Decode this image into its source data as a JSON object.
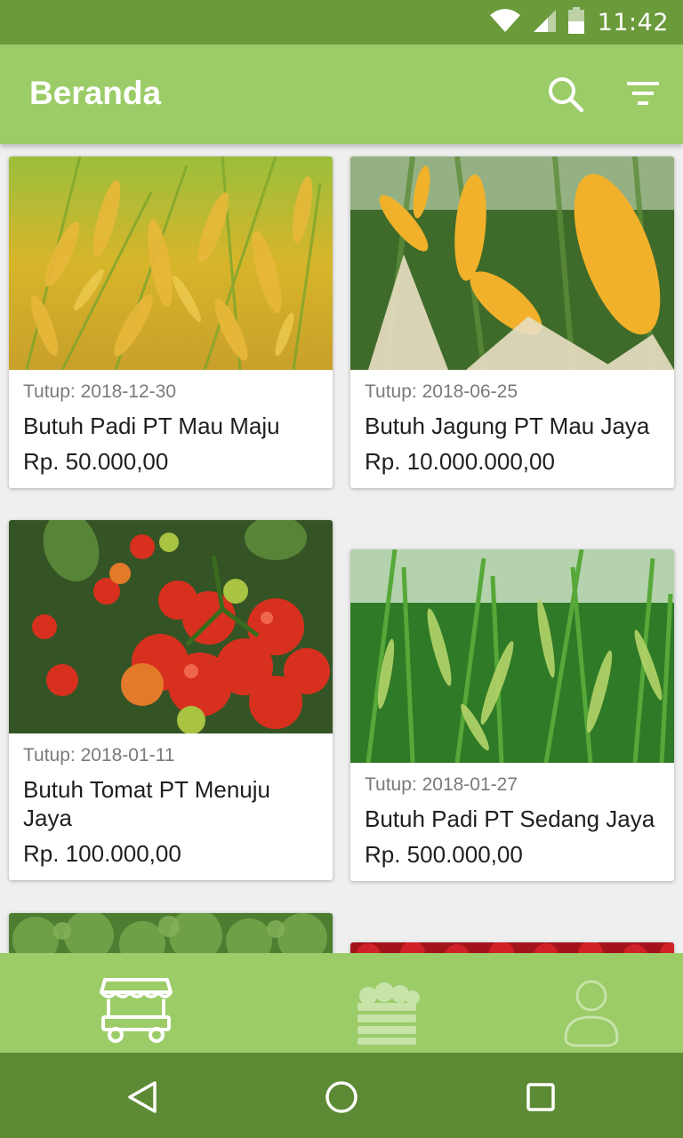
{
  "status_bar": {
    "time": "11:42",
    "icons": [
      "wifi-icon",
      "signal-icon",
      "battery-icon"
    ]
  },
  "app_bar": {
    "title": "Beranda",
    "actions": [
      "search-icon",
      "filter-icon"
    ]
  },
  "cards": [
    {
      "close_date": "Tutup: 2018-12-30",
      "title": "Butuh Padi PT Mau Maju",
      "price": "Rp. 50.000,00",
      "image": "rice-field"
    },
    {
      "close_date": "Tutup: 2018-06-25",
      "title": "Butuh Jagung PT Mau Jaya",
      "price": "Rp. 10.000.000,00",
      "image": "corn"
    },
    {
      "close_date": "Tutup: 2018-01-11",
      "title": "Butuh Tomat PT Menuju Jaya",
      "price": "Rp. 100.000,00",
      "image": "tomatoes"
    },
    {
      "close_date": "Tutup: 2018-01-27",
      "title": "Butuh Padi PT Sedang Jaya",
      "price": "Rp. 500.000,00",
      "image": "green-rice"
    }
  ],
  "bottom_nav": {
    "items": [
      "market-cart-icon",
      "produce-crate-icon",
      "profile-icon"
    ],
    "active": "market-cart-icon"
  },
  "system_nav": [
    "back-icon",
    "home-icon",
    "recents-icon"
  ],
  "colors": {
    "status_bar": "#6b9a3a",
    "app_bar": "#9bcc68",
    "system_nav": "#5d8a34",
    "background": "#efefef"
  }
}
